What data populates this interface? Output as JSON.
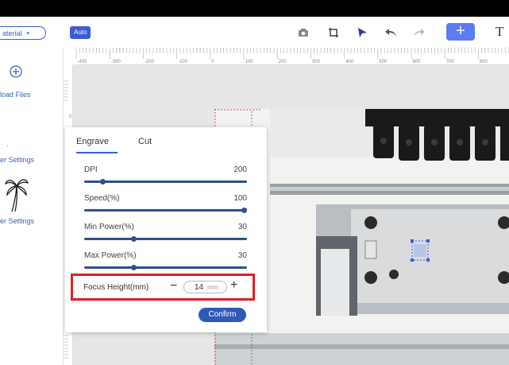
{
  "toolbar": {
    "material_label": "aterial",
    "auto_label": "Auto",
    "add_label": "+",
    "text_tool_label": "T"
  },
  "sidebar": {
    "upload_label": "load Files",
    "laser_settings_label": "er Settings",
    "image_settings_label": "er Settings"
  },
  "ruler": {
    "h_ticks": [
      "-400",
      "-300",
      "-200",
      "-100",
      "0",
      "100",
      "200",
      "300",
      "400",
      "500",
      "600",
      "700",
      "800"
    ],
    "v_ticks": [
      "0"
    ]
  },
  "panel": {
    "tabs": [
      {
        "label": "Engrave",
        "active": true
      },
      {
        "label": "Cut",
        "active": false
      }
    ],
    "settings": [
      {
        "label": "DPI",
        "value": "200",
        "level": 0.1
      },
      {
        "label": "Speed(%)",
        "value": "100",
        "level": 1.0
      },
      {
        "label": "Min Power(%)",
        "value": "30",
        "level": 0.3
      },
      {
        "label": "Max Power(%)",
        "value": "30",
        "level": 0.3
      }
    ],
    "focus": {
      "label": "Focus Height(mm)",
      "value": "14",
      "unit": "mm",
      "minus": "−",
      "plus": "+"
    },
    "confirm_label": "Confirm"
  },
  "colors": {
    "accent": "#3b5bdb",
    "slider": "#2f4f8f",
    "highlight": "#e01e26",
    "confirm": "#2f5ab8"
  }
}
